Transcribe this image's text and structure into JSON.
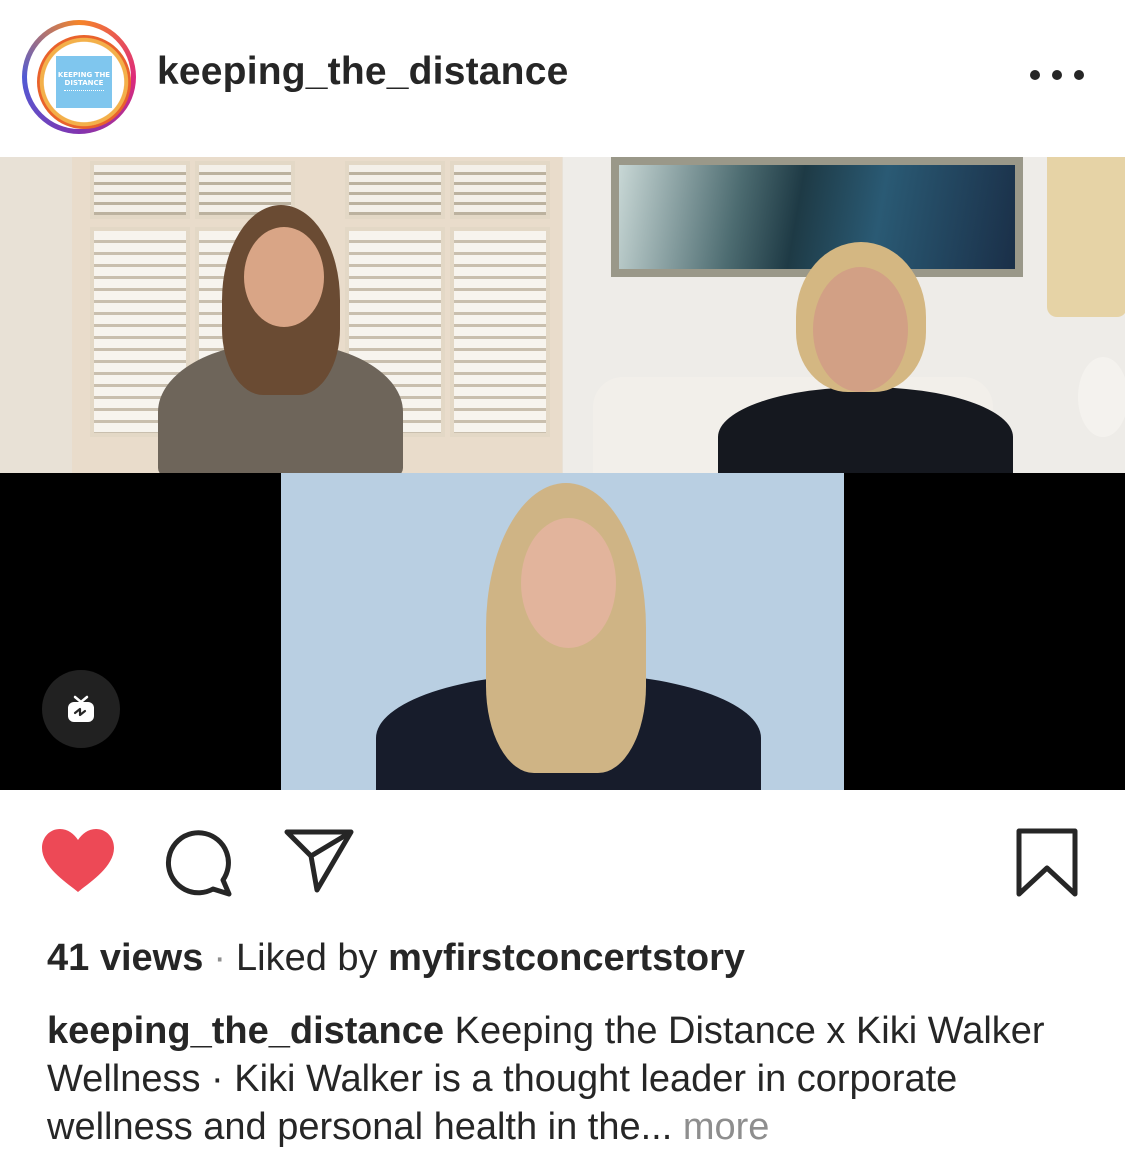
{
  "post": {
    "username": "keeping_the_distance",
    "avatar_text_line1": "KEEPING THE",
    "avatar_text_line2": "DISTANCE"
  },
  "icons": {
    "more": "more-horizontal-icon",
    "igtv": "igtv-icon",
    "like": "heart-filled-icon",
    "comment": "comment-icon",
    "share": "send-icon",
    "save": "bookmark-icon"
  },
  "colors": {
    "like": "#ed4956",
    "text": "#262626",
    "secondary": "#8e8e8e"
  },
  "stats": {
    "views": "41 views",
    "separator": "·",
    "liked_by_prefix": "Liked by",
    "liked_by_user": "myfirstconcertstory"
  },
  "caption": {
    "username": "keeping_the_distance",
    "text": "Keeping the Distance x Kiki Walker Wellness · Kiki Walker is a thought leader in corporate wellness and personal health in the...",
    "more": "more"
  }
}
